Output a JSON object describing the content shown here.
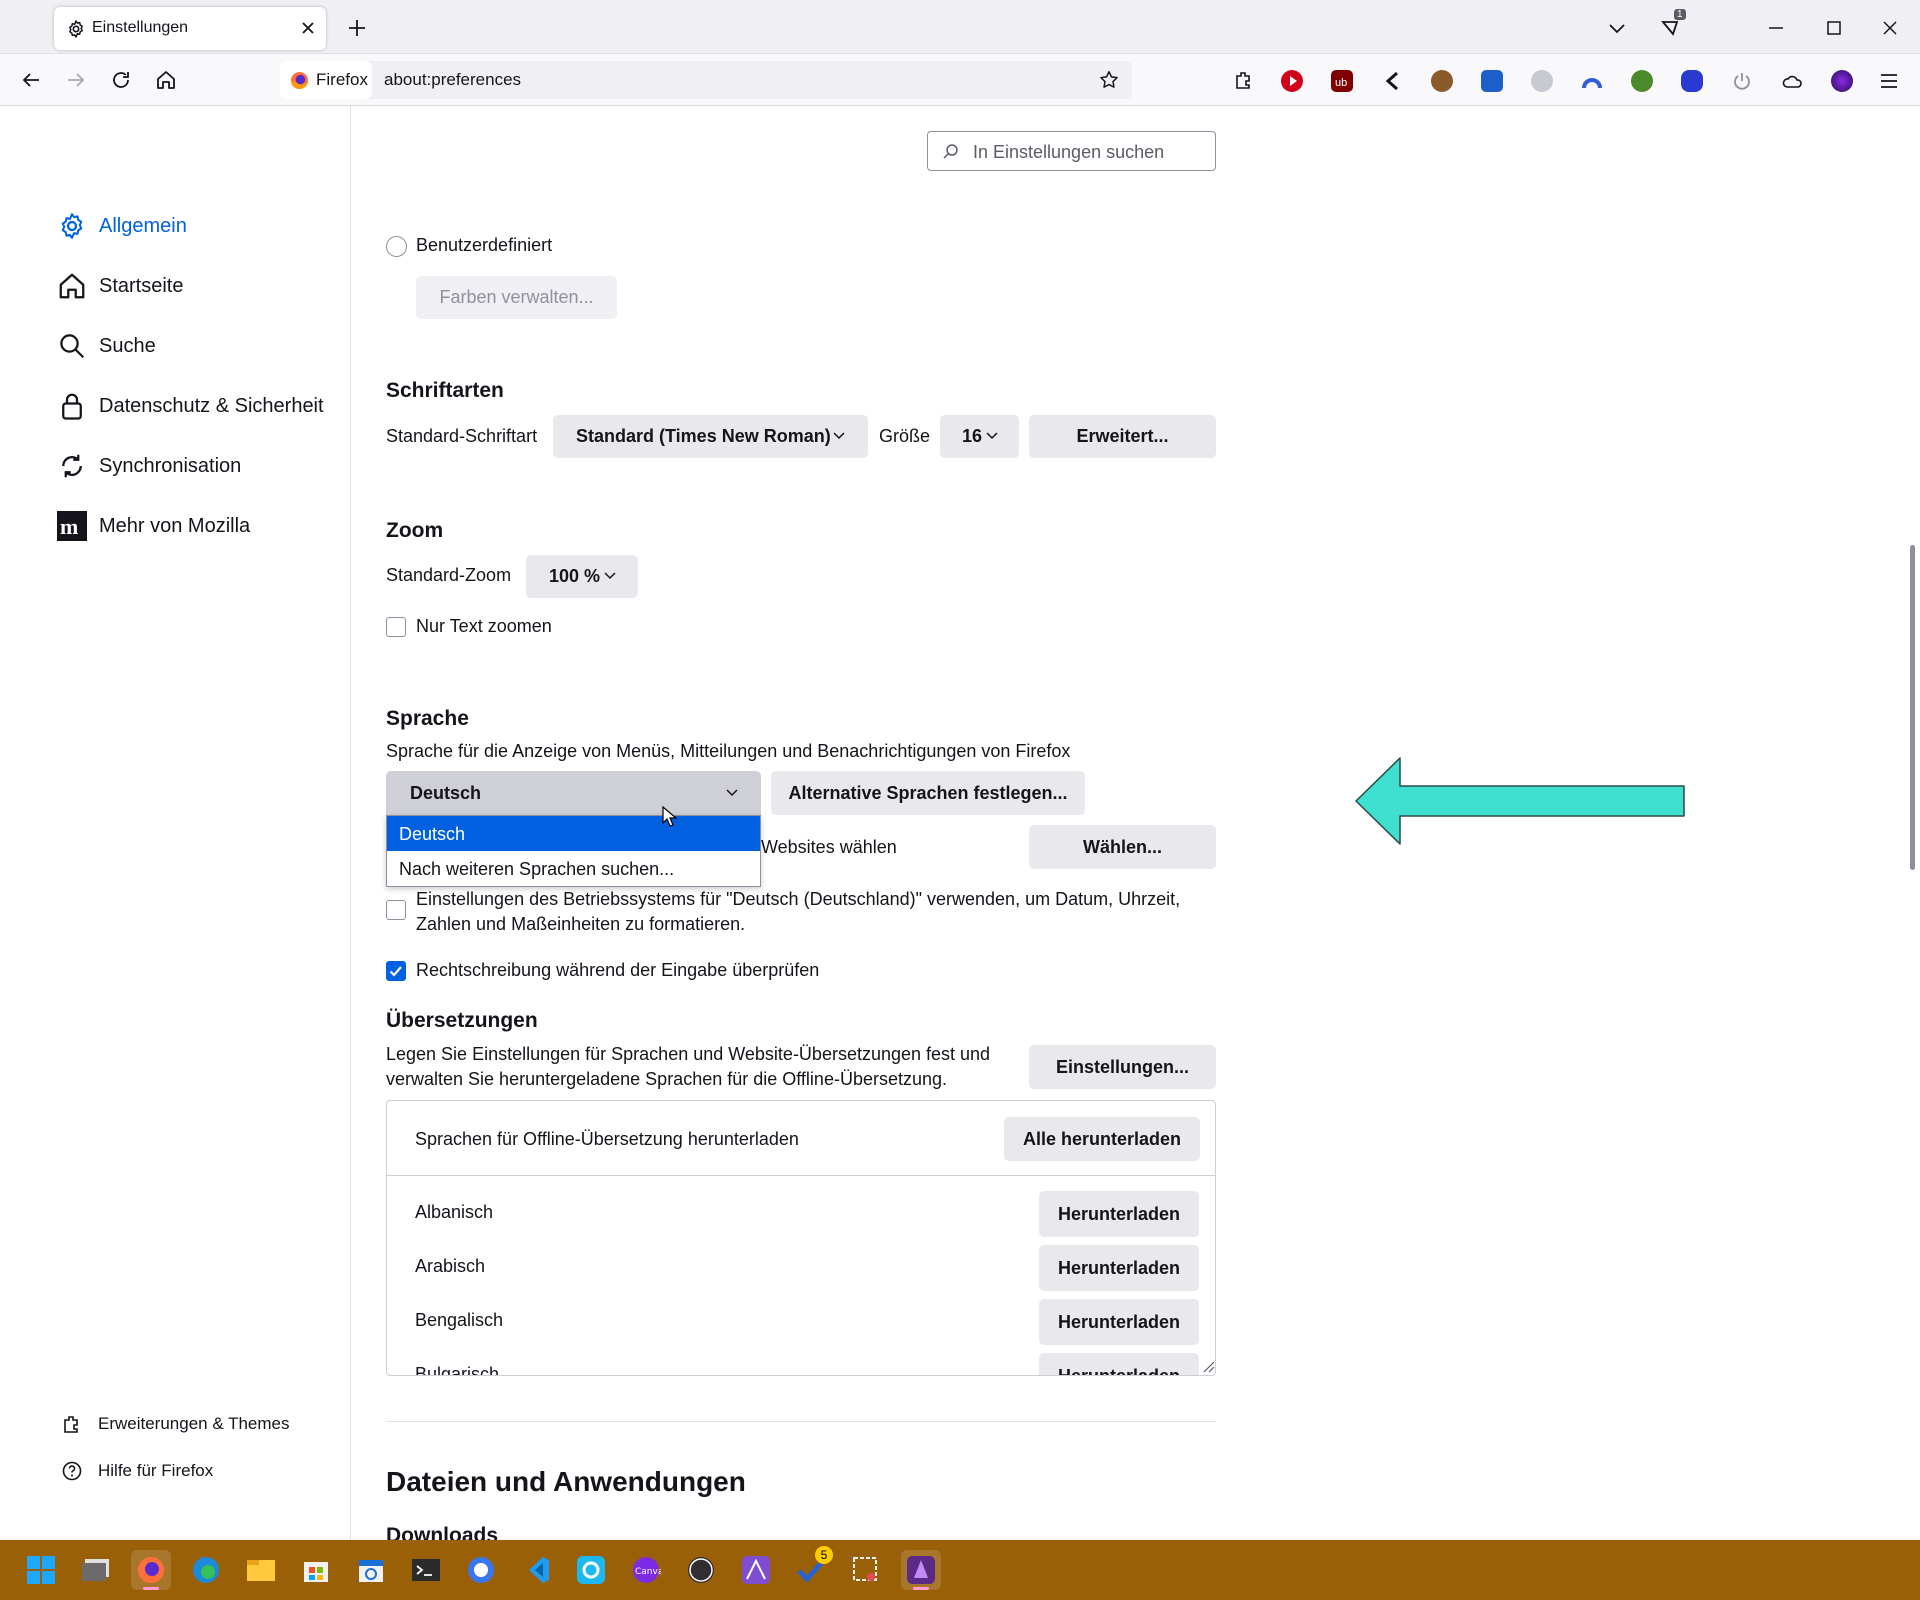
{
  "browser": {
    "tab_title": "Einstellungen",
    "tab_badge": "1",
    "url_identity": "Firefox",
    "url": "about:preferences"
  },
  "search": {
    "placeholder": "In Einstellungen suchen"
  },
  "sidebar": {
    "items": [
      {
        "label": "Allgemein",
        "icon": "gear-icon",
        "selected": true
      },
      {
        "label": "Startseite",
        "icon": "home-icon"
      },
      {
        "label": "Suche",
        "icon": "search-icon"
      },
      {
        "label": "Datenschutz & Sicherheit",
        "icon": "lock-icon"
      },
      {
        "label": "Synchronisation",
        "icon": "sync-icon"
      },
      {
        "label": "Mehr von Mozilla",
        "icon": "mozilla-icon"
      }
    ],
    "footer": [
      {
        "label": "Erweiterungen & Themes",
        "icon": "puzzle-icon"
      },
      {
        "label": "Hilfe für Firefox",
        "icon": "help-icon"
      }
    ]
  },
  "colors": {
    "radio_label": "Benutzerdefiniert",
    "manage_button": "Farben verwalten..."
  },
  "fonts": {
    "heading": "Schriftarten",
    "default_label": "Standard-Schriftart",
    "default_value": "Standard (Times New Roman)",
    "size_label": "Größe",
    "size_value": "16",
    "advanced_button": "Erweitert..."
  },
  "zoom": {
    "heading": "Zoom",
    "default_label": "Standard-Zoom",
    "default_value": "100 %",
    "text_only_label": "Nur Text zoomen",
    "text_only_checked": false
  },
  "language": {
    "heading": "Sprache",
    "description": "Sprache für die Anzeige von Menüs, Mitteilungen und Benachrichtigungen von Firefox",
    "selected": "Deutsch",
    "alternatives_button": "Alternative Sprachen festlegen...",
    "dropdown_options": [
      "Deutsch",
      "Nach weiteren Sprachen suchen..."
    ],
    "websites_label_visible": "Websites wählen",
    "choose_button": "Wählen...",
    "os_locale_label_line1": "Einstellungen des Betriebssystems für \"Deutsch (Deutschland)\" verwenden, um Datum, Uhrzeit,",
    "os_locale_label_line2": "Zahlen und Maßeinheiten zu formatieren.",
    "os_locale_checked": false,
    "spellcheck_label": "Rechtschreibung während der Eingabe überprüfen",
    "spellcheck_checked": true
  },
  "translations": {
    "heading": "Übersetzungen",
    "description_line1": "Legen Sie Einstellungen für Sprachen und Website-Übersetzungen fest und",
    "description_line2": "verwalten Sie heruntergeladene Sprachen für die Offline-Übersetzung.",
    "settings_button": "Einstellungen...",
    "offline_header": "Sprachen für Offline-Übersetzung herunterladen",
    "download_all_button": "Alle herunterladen",
    "download_button": "Herunterladen",
    "languages": [
      "Albanisch",
      "Arabisch",
      "Bengalisch",
      "Bulgarisch"
    ]
  },
  "files": {
    "heading": "Dateien und Anwendungen",
    "downloads_heading": "Downloads"
  },
  "taskbar": {
    "apps": [
      "windows-start-icon",
      "task-view-icon",
      "firefox-icon",
      "edge-icon",
      "file-explorer-icon",
      "store-icon",
      "calendar-icon",
      "terminal-icon",
      "signal-icon",
      "vscode-icon",
      "app-o-icon",
      "canva-icon",
      "obs-icon",
      "affinity-icon",
      "todo-icon",
      "snipping-icon",
      "affinity-photo-icon"
    ],
    "todo_badge": "5",
    "canva_label": "Canva"
  },
  "annotation": {
    "arrow_color": "#40e0d0"
  }
}
